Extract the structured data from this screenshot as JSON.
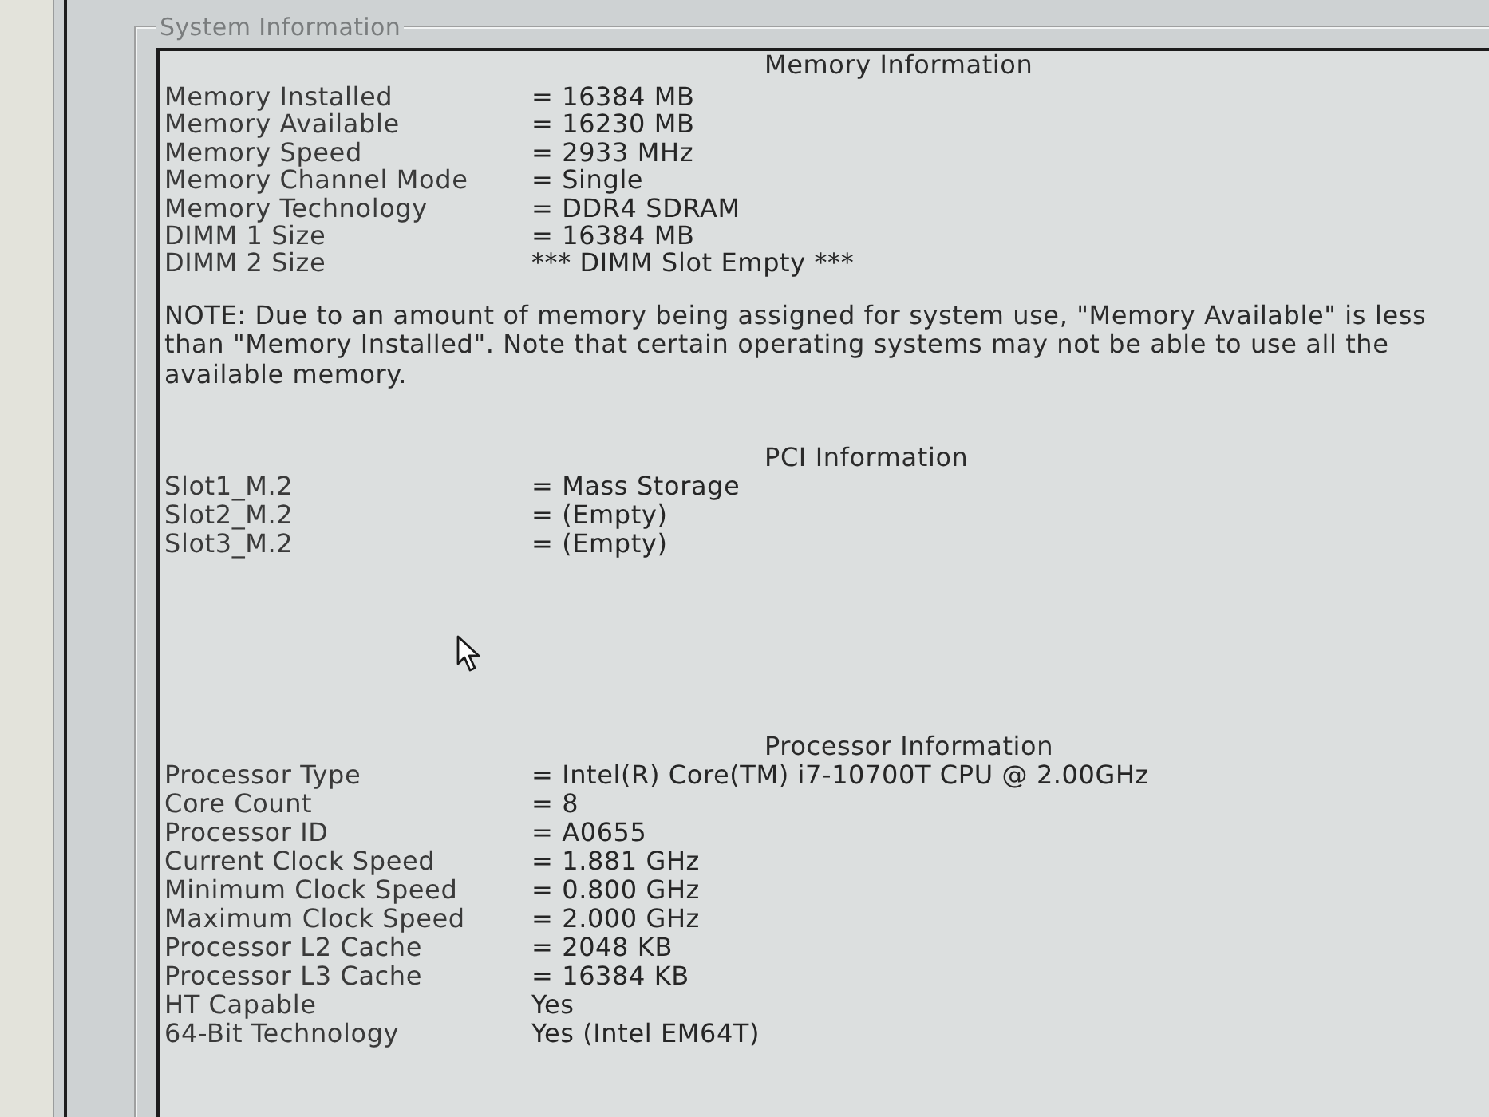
{
  "group_box": {
    "title": "System Information"
  },
  "sections": [
    {
      "title": "Memory Information",
      "rows": [
        {
          "label": "Memory Installed",
          "value": "= 16384 MB"
        },
        {
          "label": "Memory Available",
          "value": "= 16230 MB"
        },
        {
          "label": "Memory Speed",
          "value": "= 2933 MHz"
        },
        {
          "label": "Memory Channel Mode",
          "value": "= Single"
        },
        {
          "label": "Memory Technology",
          "value": "= DDR4 SDRAM"
        },
        {
          "label": "DIMM 1 Size",
          "value": "= 16384 MB"
        },
        {
          "label": "DIMM 2 Size",
          "value": "*** DIMM Slot Empty ***"
        }
      ],
      "note": "NOTE: Due to an amount of memory being assigned for system use, \"Memory Available\" is less than \"Memory Installed\". Note that certain operating systems may not be able to use all the available memory."
    },
    {
      "title": "PCI Information",
      "rows": [
        {
          "label": "Slot1_M.2",
          "value": "= Mass Storage"
        },
        {
          "label": "Slot2_M.2",
          "value": "= (Empty)"
        },
        {
          "label": "Slot3_M.2",
          "value": "= (Empty)"
        }
      ]
    },
    {
      "title": "Processor Information",
      "rows": [
        {
          "label": "Processor Type",
          "value": "= Intel(R) Core(TM) i7-10700T CPU @ 2.00GHz"
        },
        {
          "label": "Core Count",
          "value": "= 8"
        },
        {
          "label": "Processor ID",
          "value": "= A0655"
        },
        {
          "label": "Current Clock Speed",
          "value": "= 1.881 GHz"
        },
        {
          "label": "Minimum Clock Speed",
          "value": "= 0.800 GHz"
        },
        {
          "label": "Maximum Clock Speed",
          "value": "= 2.000 GHz"
        },
        {
          "label": "Processor L2 Cache",
          "value": "= 2048 KB"
        },
        {
          "label": "Processor L3 Cache",
          "value": "= 16384 KB"
        },
        {
          "label": "HT Capable",
          "value": "Yes"
        },
        {
          "label": "64-Bit Technology",
          "value": "Yes (Intel EM64T)"
        }
      ]
    }
  ]
}
